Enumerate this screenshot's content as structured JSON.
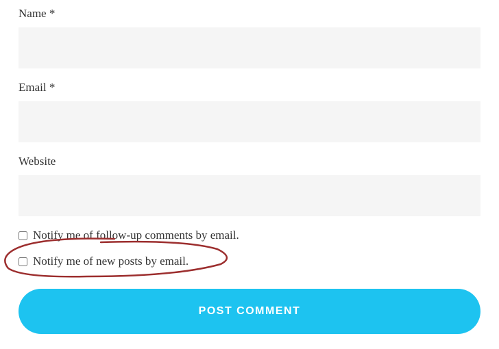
{
  "form": {
    "name": {
      "label": "Name *",
      "value": ""
    },
    "email": {
      "label": "Email *",
      "value": ""
    },
    "website": {
      "label": "Website",
      "value": ""
    },
    "notify_comments": {
      "label": "Notify me of follow-up comments by email.",
      "checked": false
    },
    "notify_posts": {
      "label": "Notify me of new posts by email.",
      "checked": false
    },
    "submit_label": "POST COMMENT"
  }
}
